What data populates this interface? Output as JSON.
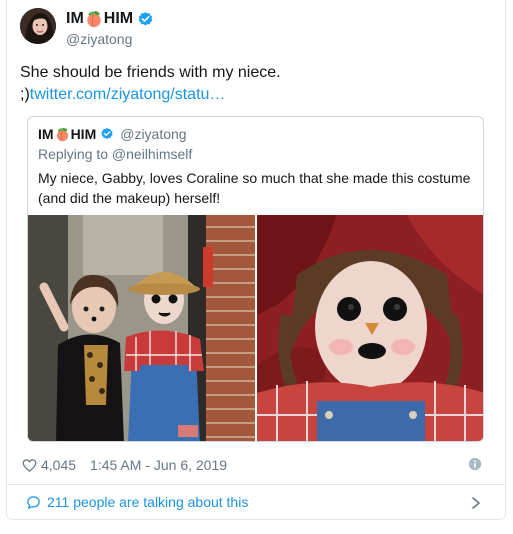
{
  "author": {
    "name_prefix": "IM",
    "name_suffix": "HIM",
    "handle": "@ziyatong",
    "verified": true
  },
  "tweet": {
    "text": "She should be friends with my niece.",
    "link_prefix": ";)",
    "link": "twitter.com/ziyatong/statu…"
  },
  "quoted": {
    "name_prefix": "IM",
    "name_suffix": "HIM",
    "handle": "@ziyatong",
    "replying_to": "Replying to @neilhimself",
    "text": "My niece, Gabby, loves Coraline so much that she made this costume (and did the makeup) herself!"
  },
  "meta": {
    "likes": "4,045",
    "timestamp": "1:45 AM - Jun 6, 2019"
  },
  "footer": {
    "talking": "211 people are talking about this"
  },
  "colors": {
    "link": "#1b95e0",
    "verified": "#1da1f2",
    "muted": "#657786"
  }
}
